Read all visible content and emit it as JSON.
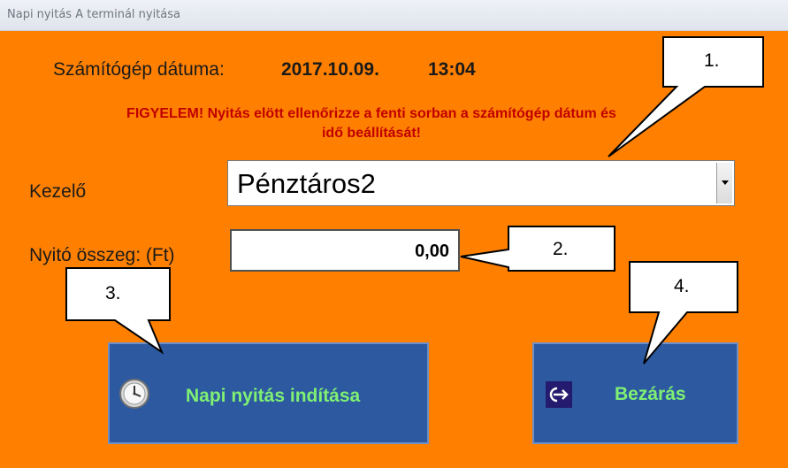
{
  "window": {
    "title": "Napi nyitás A terminál nyitása"
  },
  "info": {
    "date_label": "Számítógép dátuma:",
    "date_value": "2017.10.09.",
    "time_value": "13:04",
    "warning_line1": "FIGYELEM! Nyitás elött ellenőrizze a fenti sorban a számítógép dátum és",
    "warning_line2": "idő beállítását!"
  },
  "form": {
    "kezelo_label": "Kezelő",
    "kezelo_value": "Pénztáros2",
    "nyito_label": "Nyitó összeg: (Ft)",
    "nyito_value": "0,00"
  },
  "buttons": {
    "start_label": "Napi nyitás indítása",
    "close_label": "Bezárás"
  },
  "callouts": {
    "c1": "1.",
    "c2": "2.",
    "c3": "3.",
    "c4": "4."
  },
  "colors": {
    "background": "#ff8000",
    "button": "#2c59a0",
    "button_text": "#7ff073",
    "warning": "#c00000"
  },
  "icons": {
    "start": "clock-icon",
    "close": "exit-arrow-icon"
  }
}
